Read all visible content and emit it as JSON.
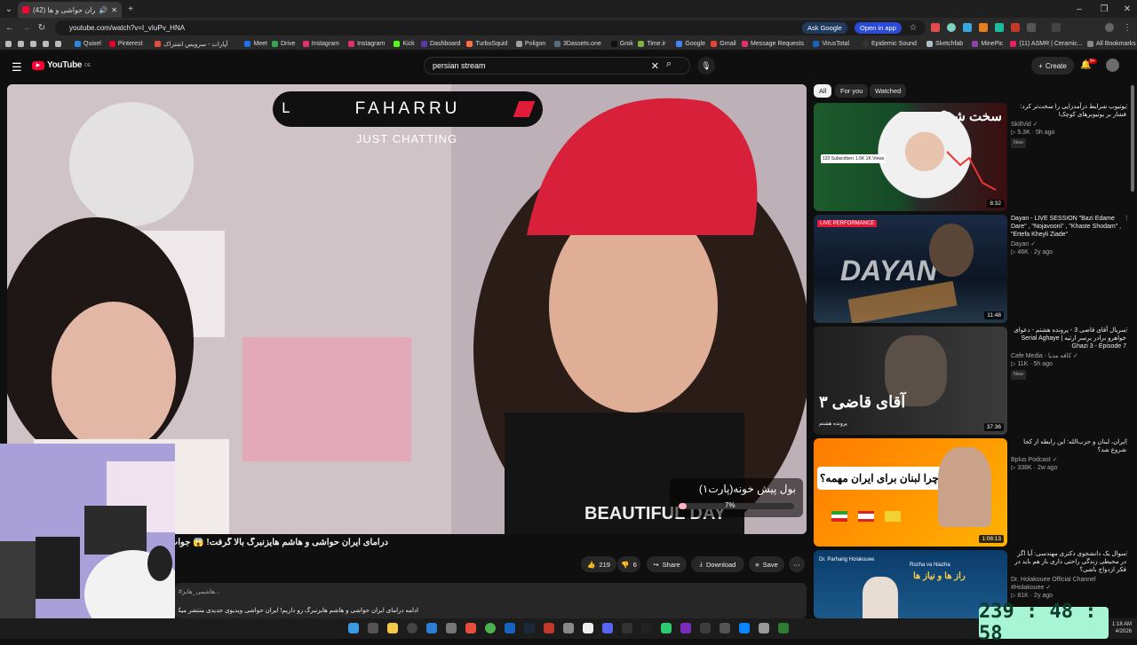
{
  "browser": {
    "tab_title": "درامای ایران حواشی و ها (42)",
    "url": "youtube.com/watch?v=I_vIuPv_HNA",
    "ask_google": "Ask Google",
    "open_in_app": "Open in app",
    "bookmarks": [
      "Quixel",
      "Pinterest",
      "آپارات - سرویس اشتراک",
      "Meet",
      "Drive",
      "Instagram",
      "Instagram",
      "Kick",
      "Dashboard",
      "TurboSquid",
      "Poligon",
      "3Dassets.one",
      "Grok",
      "Time.ir",
      "Google",
      "Gmail",
      "Message Requests",
      "VirusTotal",
      "Epidemic Sound",
      "Sketchfab",
      "MinePic",
      "(11) ASMR | Ceramic..."
    ],
    "all_bookmarks": "All Bookmarks"
  },
  "youtube": {
    "logo": "YouTube",
    "logo_region": "DE",
    "search_value": "persian stream",
    "create_label": "Create",
    "notif_count": "9+"
  },
  "video": {
    "overlay_brand": "FAHARRU",
    "overlay_category": "JUST CHATTING",
    "overlay_goal": "بول پیش خونه(پارت۱)",
    "overlay_percent": "7%",
    "shirt_text": "BEAUTIFUL DAY",
    "progress": 0.07,
    "title": "درامای ایران حواشی و هاشم هایزنبرگ بالا گرفت! 😱 جواب",
    "likes": "219",
    "dislikes": "6",
    "share": "Share",
    "download": "Download",
    "save": "Save",
    "desc_tag": "#هاشمی_هایز...",
    "desc_text": "ادامه درامای ایران حواشی و هاشم هایزنبرگ رو داریم! ایران حواشی ویدیوی جدیدی منتشر میکنه"
  },
  "filters": [
    "All",
    "For you",
    "Watched"
  ],
  "recommendations": [
    {
      "title": "یوتیوب شرایط درآمدزایی را سخت‌تر کرد: فشار بر یوتیوبرهای کوچک!",
      "channel": "SkillVid",
      "views": "5.3K",
      "age": "5h ago",
      "badge": "New",
      "duration": "8:32",
      "thumb_text": "سخت شد؟",
      "stats": [
        "122 Subscribers",
        "1.5K 1K Views",
        "0"
      ]
    },
    {
      "title": "Dayan - LIVE SESSION \"Bazi Edame Dare\" , \"Nojavooni\" , \"Khaste Shodam\" , \"Ertefa Kheyli Ziade\"",
      "channel": "Dayan",
      "views": "46K",
      "age": "2y ago",
      "badge": "",
      "duration": "11:48",
      "thumb_text": "DAYAN",
      "thumb_badge": "LIVE PERFORMANCE"
    },
    {
      "title": "سریال آقای قاضی 3 - پرونده هشتم - دعوای خواهرو برادر برسر ارثیه | Serial Aghaye Ghazi 3 - Episode 7",
      "channel": "Cafe Media - کافه مدیا",
      "views": "11K",
      "age": "5h ago",
      "badge": "New",
      "duration": "37:36",
      "thumb_text": "آقای قاضی ۳",
      "thumb_sub": "پرونده هشتم"
    },
    {
      "title": "ایران، لبنان و حزب‌الله: این رابطه از کجا شروع شد؟",
      "channel": "Bplus Podcast",
      "views": "338K",
      "age": "2w ago",
      "badge": "",
      "duration": "1:08:13",
      "thumb_text": "چرا لبنان برای ایران مهمه؟"
    },
    {
      "title": "سوال یک دانشجوی دکتری مهندسی: آیا اگر در محیطی زندگی راحتی داری باز هم باید در فکر ازدواج باشی؟",
      "channel": "Dr. Holakouee Official Channel #Holakouee",
      "views": "81K",
      "age": "2y ago",
      "badge": "",
      "duration": "",
      "thumb_text": "راز ها و نیاز ها",
      "thumb_header": "Dr. Parhang Holakouee",
      "thumb_sub": "Rozha va Niazha"
    }
  ],
  "timer": {
    "value": "239 : 48 : 58"
  },
  "taskbar": {
    "time": "1:18 AM",
    "date": "4/2026"
  },
  "colors": {
    "accent_red": "#ff0033",
    "timer_bg": "#a8f5d6",
    "bg": "#0f0f0f"
  }
}
